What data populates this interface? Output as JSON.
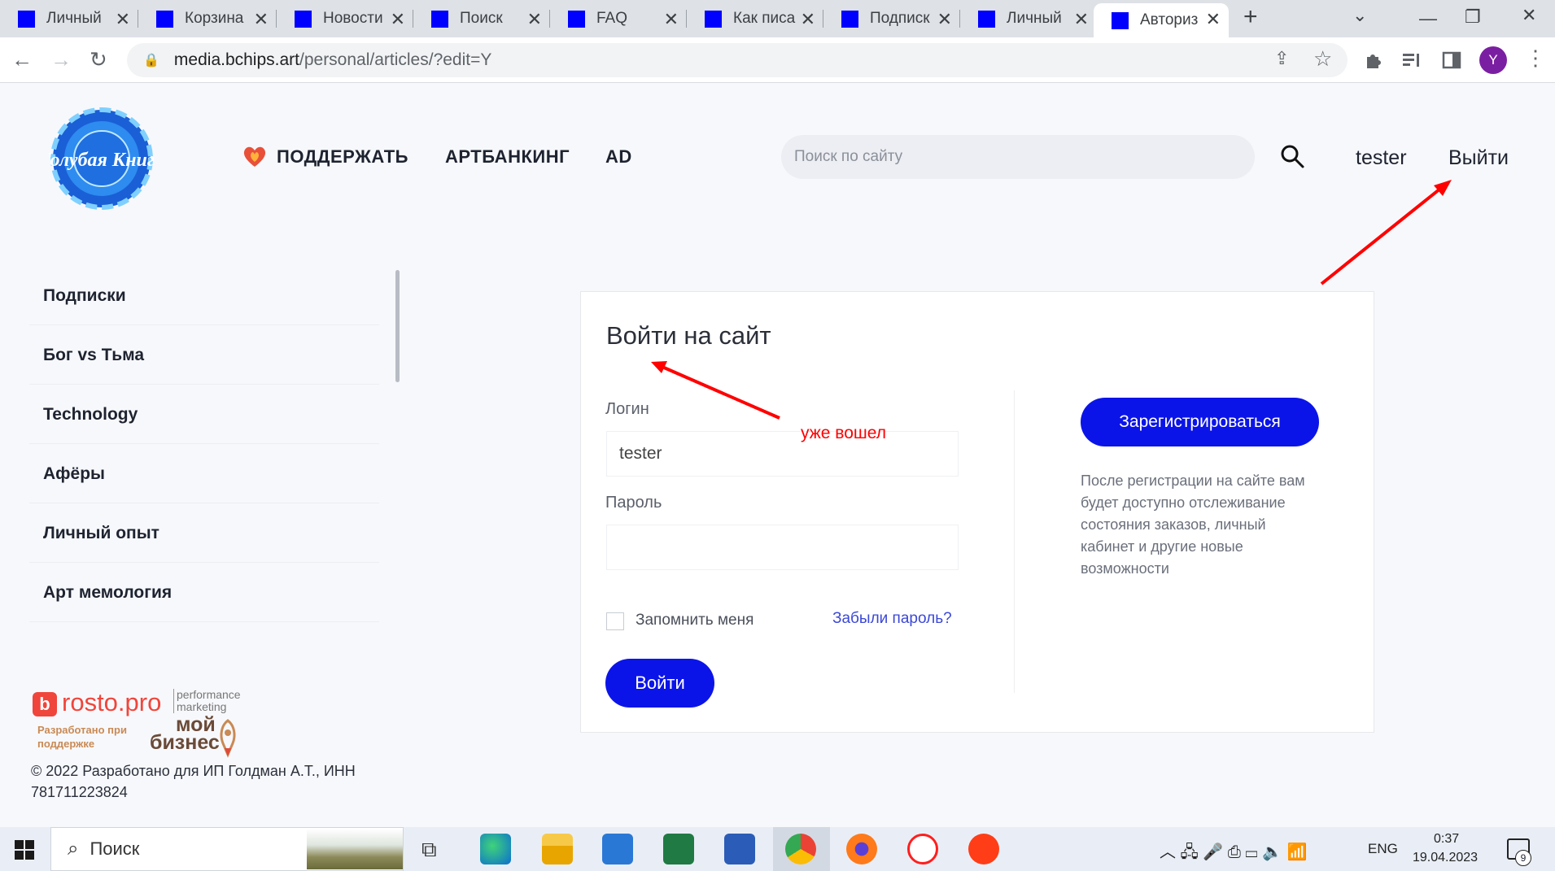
{
  "browser": {
    "tabs": [
      {
        "title": "Личный",
        "active": false
      },
      {
        "title": "Корзина",
        "active": false
      },
      {
        "title": "Новости",
        "active": false
      },
      {
        "title": "Поиск",
        "active": false
      },
      {
        "title": "FAQ",
        "active": false
      },
      {
        "title": "Как писа",
        "active": false
      },
      {
        "title": "Подписк",
        "active": false
      },
      {
        "title": "Личный",
        "active": false
      },
      {
        "title": "Авториз",
        "active": true
      }
    ],
    "url_host": "media.bchips.art",
    "url_path": "/personal/articles/?edit=Y",
    "profile_initial": "Y",
    "favicon_color": "#0000ff"
  },
  "site": {
    "logo_text": "Голубая Книга",
    "nav": {
      "support": "ПОДДЕРЖАТЬ",
      "artbanking": "АРТБАНКИНГ",
      "ad": "AD"
    },
    "search_placeholder": "Поиск по сайту",
    "username": "tester",
    "logout": "Выйти"
  },
  "sidebar": {
    "items": [
      "Подписки",
      "Бог vs Тьма",
      "Technology",
      "Афёры",
      "Личный опыт",
      "Арт мемология"
    ]
  },
  "footer": {
    "rosto_text": "rosto.pro",
    "rosto_tag": "performance marketing",
    "dev_support": "Разработано при поддержке",
    "moy_biznes_1": "мой",
    "moy_biznes_2": "бизнес",
    "copyright": "© 2022 Разработано для ИП Голдман А.Т., ИНН 781711223824"
  },
  "login": {
    "title": "Войти на сайт",
    "login_label": "Логин",
    "login_value": "tester",
    "password_label": "Пароль",
    "password_value": "",
    "remember_label": "Запомнить меня",
    "forgot_link": "Забыли пароль?",
    "submit": "Войти",
    "register": "Зарегистрироваться",
    "register_info": "После регистрации на сайте вам будет доступно отслеживание состояния заказов, личный кабинет и другие новые возможности"
  },
  "annotation": {
    "note": "уже вошел",
    "color": "#ff0000"
  },
  "taskbar": {
    "search_label": "Поиск",
    "lang": "ENG",
    "time": "0:37",
    "date": "19.04.2023",
    "notifications": "9"
  },
  "colors": {
    "primary_button": "#0b14e8",
    "link": "#3b48d8"
  }
}
